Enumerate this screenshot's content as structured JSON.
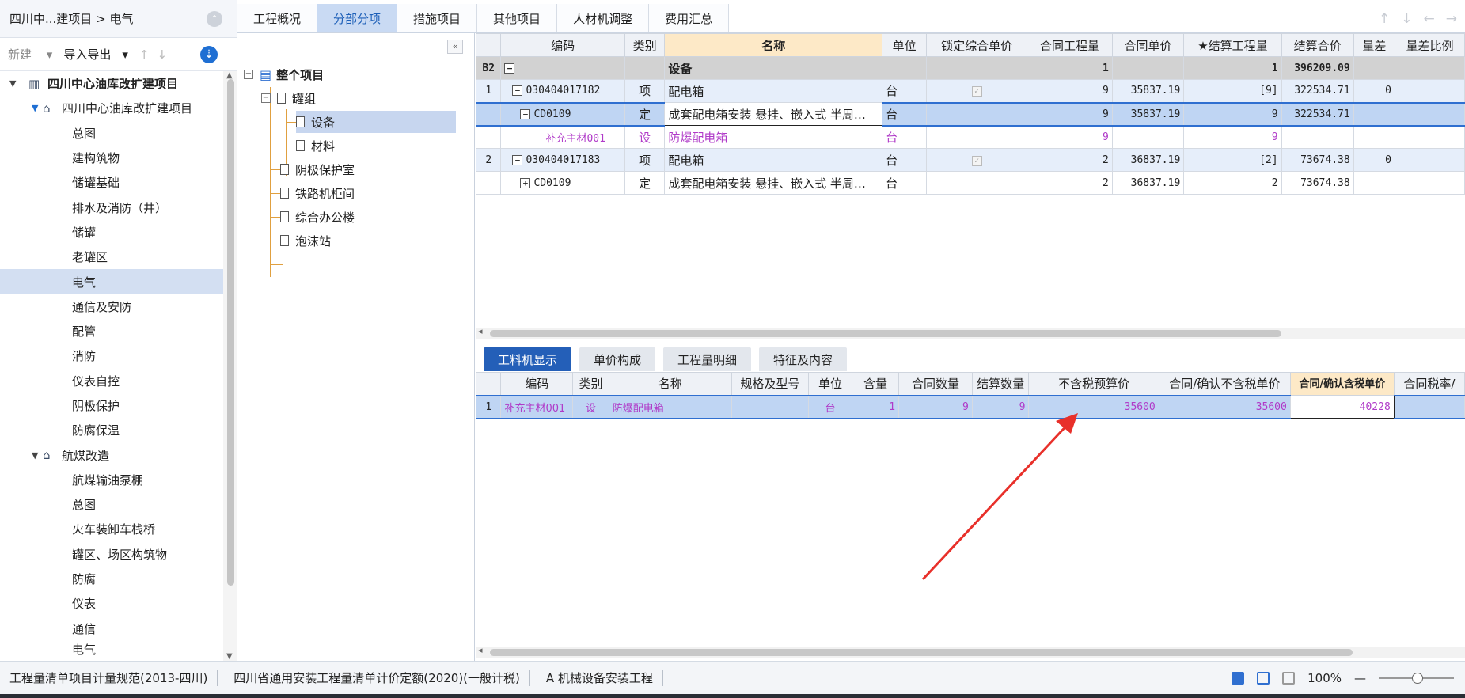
{
  "left": {
    "breadcrumb": "四川中...建项目 > 电气",
    "toolbar": {
      "new": "新建",
      "import_export": "导入导出"
    },
    "root": "四川中心油库改扩建项目",
    "sub_root": "四川中心油库改扩建项目",
    "items": [
      "总图",
      "建构筑物",
      "储罐基础",
      "排水及消防（井）",
      "储罐",
      "老罐区",
      "电气",
      "通信及安防",
      "配管",
      "消防",
      "仪表自控",
      "阴极保护",
      "防腐保温"
    ],
    "group2": "航煤改造",
    "items2": [
      "航煤输油泵棚",
      "总图",
      "火车装卸车栈桥",
      "罐区、场区构筑物",
      "防腐",
      "仪表",
      "通信",
      "电气"
    ],
    "selected": "电气"
  },
  "tabs": [
    "工程概况",
    "分部分项",
    "措施项目",
    "其他项目",
    "人材机调整",
    "费用汇总"
  ],
  "active_tab": "分部分项",
  "midtree": {
    "root": "整个项目",
    "n1": "罐组",
    "n1a": "设备",
    "n1b": "材料",
    "n2": "阴极保护室",
    "n3": "铁路机柜间",
    "n4": "综合办公楼",
    "n5": "泡沫站"
  },
  "upper": {
    "headers": [
      "编码",
      "类别",
      "名称",
      "单位",
      "锁定综合单价",
      "合同工程量",
      "合同单价",
      "★结算工程量",
      "结算合价",
      "量差",
      "量差比例"
    ],
    "rows": [
      {
        "idx": "B2",
        "code": "",
        "type": "",
        "name": "设备",
        "unit": "",
        "qty": "1",
        "price": "",
        "sqty": "1",
        "stotal": "396209.09",
        "diff": ""
      },
      {
        "idx": "1",
        "code": "030404017182",
        "type": "项",
        "name": "配电箱",
        "unit": "台",
        "qty": "9",
        "price": "35837.19",
        "sqty": "[9]",
        "stotal": "322534.71",
        "diff": "0"
      },
      {
        "idx": "",
        "code": "CD0109",
        "type": "定",
        "name": "成套配电箱安装 悬挂、嵌入式 半周…",
        "unit": "台",
        "qty": "9",
        "price": "35837.19",
        "sqty": "9",
        "stotal": "322534.71",
        "diff": ""
      },
      {
        "idx": "",
        "code": "补充主材001",
        "type": "设",
        "name": "防爆配电箱",
        "unit": "台",
        "qty": "9",
        "price": "",
        "sqty": "9",
        "stotal": "",
        "diff": ""
      },
      {
        "idx": "2",
        "code": "030404017183",
        "type": "项",
        "name": "配电箱",
        "unit": "台",
        "qty": "2",
        "price": "36837.19",
        "sqty": "[2]",
        "stotal": "73674.38",
        "diff": "0"
      },
      {
        "idx": "",
        "code": "CD0109",
        "type": "定",
        "name": "成套配电箱安装 悬挂、嵌入式 半周…",
        "unit": "台",
        "qty": "2",
        "price": "36837.19",
        "sqty": "2",
        "stotal": "73674.38",
        "diff": ""
      }
    ]
  },
  "subtabs": [
    "工料机显示",
    "单价构成",
    "工程量明细",
    "特征及内容"
  ],
  "lower": {
    "headers": [
      "编码",
      "类别",
      "名称",
      "规格及型号",
      "单位",
      "含量",
      "合同数量",
      "结算数量",
      "不含税预算价",
      "合同/确认不含税单价",
      "合同/确认含税单价",
      "合同税率/"
    ],
    "row": {
      "idx": "1",
      "code": "补充主材001",
      "type": "设",
      "name": "防爆配电箱",
      "spec": "",
      "unit": "台",
      "content": "1",
      "cqty": "9",
      "sqty": "9",
      "budget": "35600",
      "confirm": "35600",
      "taxprice": "40228"
    }
  },
  "status": {
    "s1": "工程量清单项目计量规范(2013-四川)",
    "s2": "四川省通用安装工程量清单计价定额(2020)(一般计税)",
    "s3": "A 机械设备安装工程",
    "zoom": "100%"
  }
}
